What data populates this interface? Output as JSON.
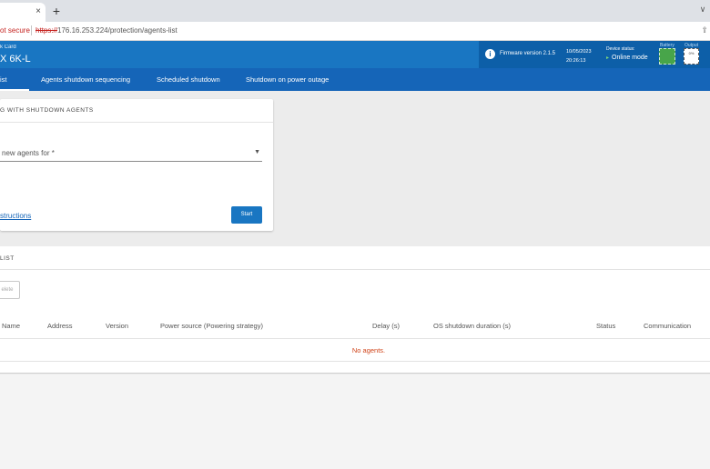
{
  "browser": {
    "tab_close": "×",
    "new_tab": "+",
    "tab_menu": "∨",
    "not_secure": "ot secure",
    "url_scheme": "https://",
    "url_rest": "176.16.253.224/protection/agents-list",
    "share_icon": "share-icon"
  },
  "header": {
    "card_subtitle": "k Card",
    "model": "X 6K-L",
    "firmware": "Firmware version  2.1.5",
    "date": "10/05/2023",
    "time": "20:26:13",
    "device_status_label": "Device status:",
    "device_status_value": "Online mode",
    "battery_label": "Battery",
    "output_label": "Output",
    "output_value": "0%",
    "status_color": "#7cd67c"
  },
  "nav": {
    "items": [
      "ist",
      "Agents shutdown sequencing",
      "Scheduled shutdown",
      "Shutdown on power outage"
    ]
  },
  "pairing": {
    "title": "G WITH SHUTDOWN AGENTS",
    "select_placeholder": "new agents for *",
    "instructions_link": "structions",
    "start_button": "Start"
  },
  "agents_list": {
    "title": "LIST",
    "delete_button": "elete",
    "columns": [
      "Name",
      "Address",
      "Version",
      "Power source (Powering strategy)",
      "Delay (s)",
      "OS shutdown duration (s)",
      "Status",
      "Communication"
    ],
    "empty_message": "No agents."
  }
}
